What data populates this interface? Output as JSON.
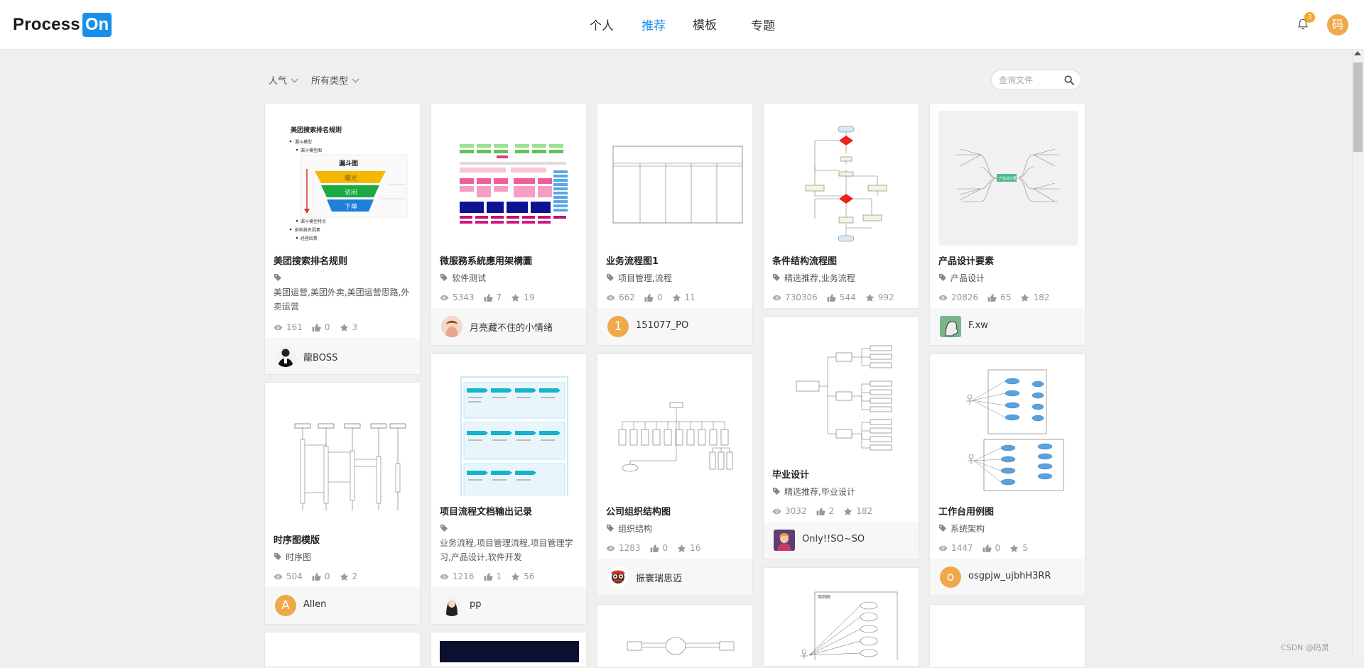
{
  "app": {
    "logo_text": "Process",
    "logo_box": "On"
  },
  "nav": [
    {
      "label": "个人",
      "active": false
    },
    {
      "label": "推荐",
      "active": true
    },
    {
      "label": "模板",
      "active": false
    },
    {
      "label": "专题",
      "active": false
    }
  ],
  "notifications": {
    "count": "3"
  },
  "user": {
    "avatar_initial": "码"
  },
  "filters": {
    "sort": "人气",
    "type": "所有类型"
  },
  "search": {
    "placeholder": "查询文件"
  },
  "cards": [
    {
      "title": "美团搜索排名规则",
      "tags": "",
      "tags2": "美团运营,美团外卖,美团运营思路,外卖运营",
      "views": "161",
      "likes": "0",
      "stars": "3",
      "author": "龍BOSS",
      "avatar": "photo",
      "thumb": {
        "heading": "美团搜索排名规则",
        "l1": "漏斗模型",
        "l2": "漏斗模型图",
        "funnel_title": "漏斗图",
        "f1": "曝光",
        "f2": "访问",
        "f3": "下单",
        "l3": "漏斗模型特点",
        "l4": "影响排名因素",
        "l5": "经营因素"
      }
    },
    {
      "title": "微服務系統應用架構圖",
      "tags": "软件测试",
      "views": "5343",
      "likes": "7",
      "stars": "19",
      "author": "月亮藏不住的小情绪",
      "avatar": "photo"
    },
    {
      "title": "业务流程图1",
      "tags": "项目管理,流程",
      "views": "662",
      "likes": "0",
      "stars": "11",
      "author": "151077_PO",
      "avatar": "1"
    },
    {
      "title": "条件结构流程图",
      "tags": "精选推荐,业务流程",
      "views": "730306",
      "likes": "544",
      "stars": "992",
      "author": "",
      "avatar": ""
    },
    {
      "title": "产品设计要素",
      "tags": "产品设计",
      "views": "20826",
      "likes": "65",
      "stars": "182",
      "author": "F.xw",
      "avatar": "photo",
      "thumb": {
        "center": "产品设计要素"
      }
    },
    {
      "title": "时序图模版",
      "tags": "时序图",
      "views": "504",
      "likes": "0",
      "stars": "2",
      "author": "Allen",
      "avatar": "A"
    },
    {
      "title": "项目流程文档输出记录",
      "tags": "",
      "tags2": "业务流程,项目管理流程,项目管理学习,产品设计,软件开发",
      "views": "1216",
      "likes": "1",
      "stars": "56",
      "author": "pp",
      "avatar": "photo"
    },
    {
      "title": "公司组织结构图",
      "tags": "组织结构",
      "views": "1283",
      "likes": "0",
      "stars": "16",
      "author": "振寰瑞思迈",
      "avatar": "photo"
    },
    {
      "title": "毕业设计",
      "tags": "精选推荐,毕业设计",
      "views": "3032",
      "likes": "2",
      "stars": "182",
      "author": "Only!!SO~SO",
      "avatar": "photo"
    },
    {
      "title": "工作台用例图",
      "tags": "系统架构",
      "views": "1447",
      "likes": "0",
      "stars": "5",
      "author": "osgpjw_ujbhH3RR",
      "avatar": "o"
    }
  ],
  "watermark": "CSDN @码灵",
  "colors": {
    "accent": "#1890e8",
    "avatar_orange": "#f0a94a",
    "badge": "#f5a623"
  }
}
